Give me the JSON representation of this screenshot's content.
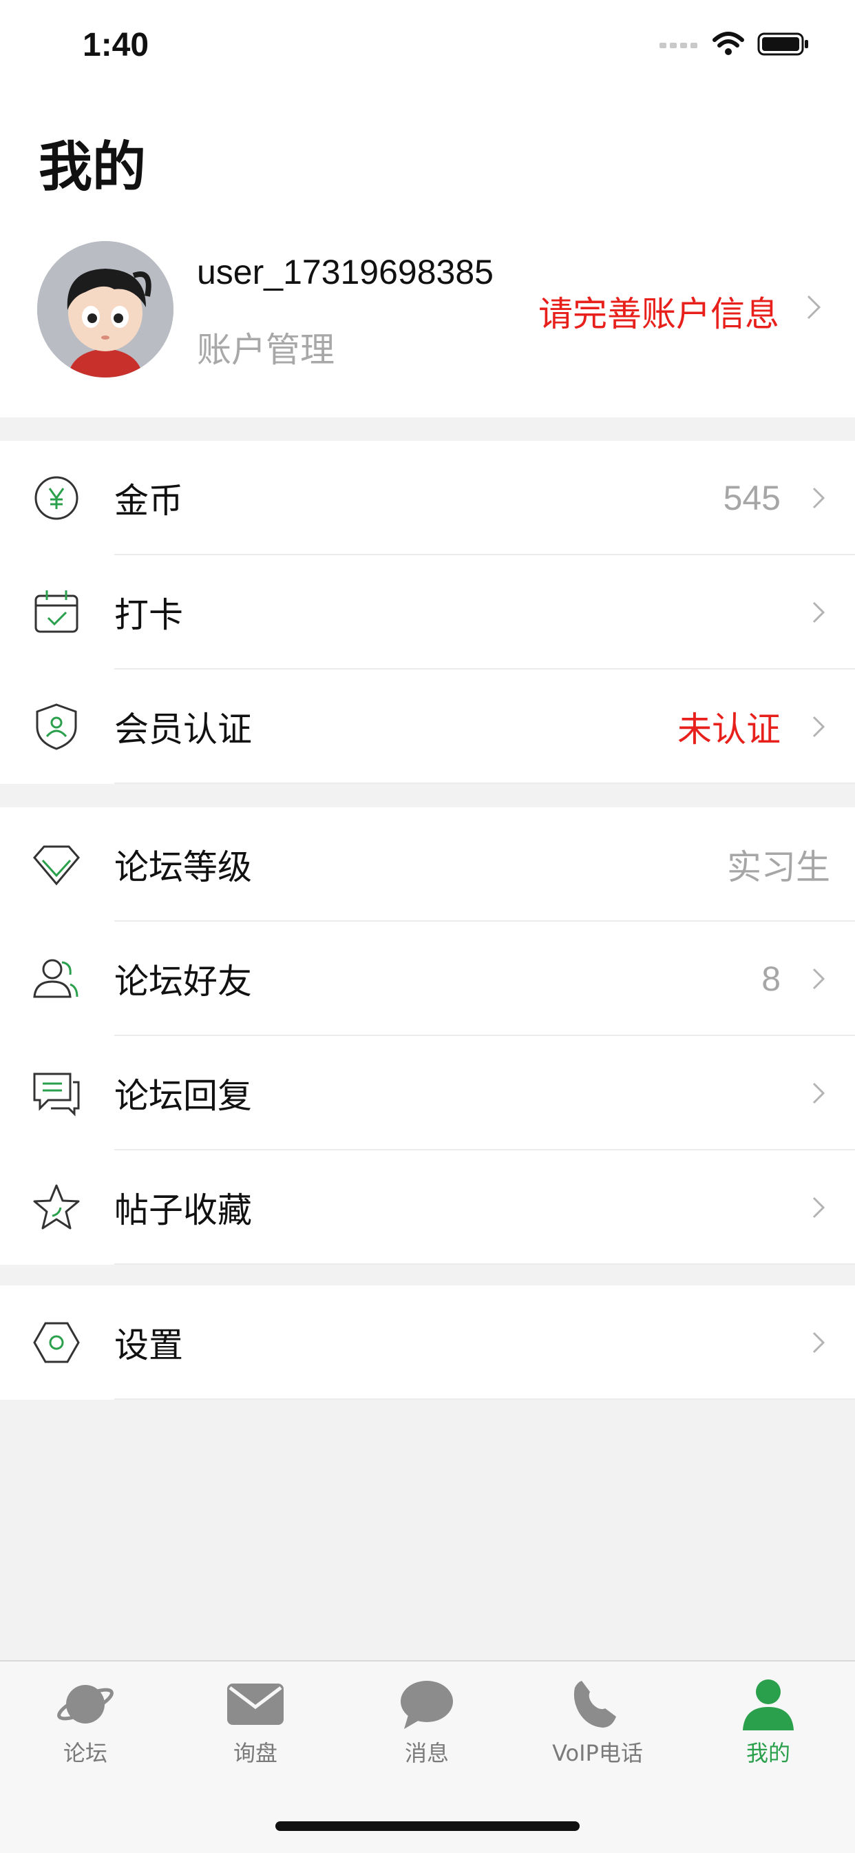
{
  "status_bar": {
    "time": "1:40"
  },
  "page_title": "我的",
  "profile": {
    "username": "user_17319698385",
    "account_management": "账户管理",
    "complete_info_link": "请完善账户信息"
  },
  "groups": [
    [
      {
        "icon": "coin-yen-icon",
        "label": "金币",
        "value": "545",
        "chevron": true
      },
      {
        "icon": "calendar-check-icon",
        "label": "打卡",
        "value": "",
        "chevron": true
      },
      {
        "icon": "shield-user-icon",
        "label": "会员认证",
        "value": "未认证",
        "value_color": "#e8201c",
        "chevron": true
      }
    ],
    [
      {
        "icon": "diamond-icon",
        "label": "论坛等级",
        "value": "实习生",
        "chevron": false
      },
      {
        "icon": "friends-icon",
        "label": "论坛好友",
        "value": "8",
        "chevron": true
      },
      {
        "icon": "chat-reply-icon",
        "label": "论坛回复",
        "value": "",
        "chevron": true
      },
      {
        "icon": "star-icon",
        "label": "帖子收藏",
        "value": "",
        "chevron": true
      }
    ],
    [
      {
        "icon": "settings-hexagon-icon",
        "label": "设置",
        "value": "",
        "chevron": true
      }
    ]
  ],
  "tabbar": {
    "items": [
      {
        "icon": "planet-icon",
        "label": "论坛",
        "active": false
      },
      {
        "icon": "mail-icon",
        "label": "询盘",
        "active": false
      },
      {
        "icon": "chat-bubble-icon",
        "label": "消息",
        "active": false
      },
      {
        "icon": "phone-icon",
        "label": "VoIP电话",
        "active": false
      },
      {
        "icon": "person-icon",
        "label": "我的",
        "active": true
      }
    ]
  },
  "colors": {
    "accent": "#2aa04c",
    "alert": "#e8201c",
    "muted": "#a6a6a6"
  }
}
